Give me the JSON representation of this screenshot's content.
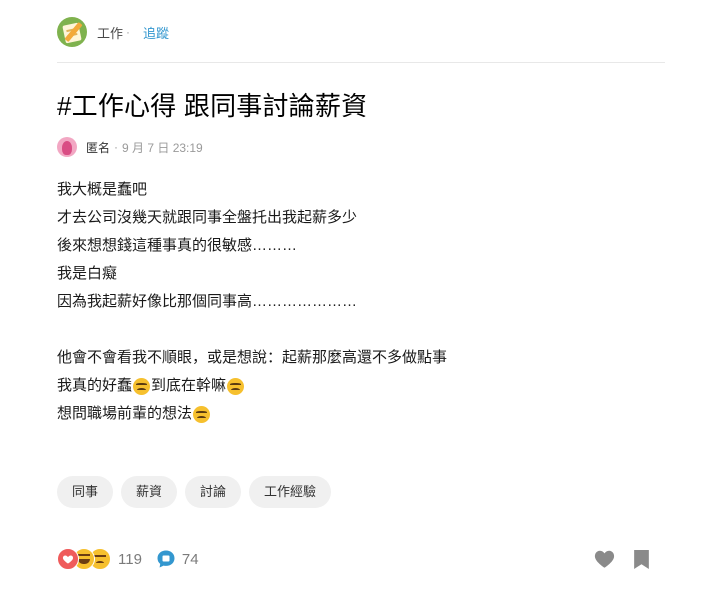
{
  "header": {
    "forum_name": "工作",
    "separator": "·",
    "follow_label": "追蹤"
  },
  "post": {
    "title": "#工作心得 跟同事討論薪資",
    "author": "匿名",
    "meta_separator": "·",
    "time": "9 月 7 日 23:19",
    "lines": [
      {
        "text": "我大概是蠢吧"
      },
      {
        "text": "才去公司沒幾天就跟同事全盤托出我起薪多少"
      },
      {
        "text": "後來想想錢這種事真的很敏感………"
      },
      {
        "text": "我是白癡"
      },
      {
        "text": "因為我起薪好像比那個同事高…………………"
      },
      {
        "text": ""
      },
      {
        "text": "他會不會看我不順眼，或是想說：起薪那麼高還不多做點事"
      },
      {
        "segments": [
          "我真的好蠢",
          "到底在幹嘛",
          ""
        ]
      },
      {
        "segments": [
          "想問職場前輩的想法",
          ""
        ]
      }
    ],
    "emoji_icon": "persevere-face-emoji"
  },
  "tags": [
    "同事",
    "薪資",
    "討論",
    "工作經驗"
  ],
  "footer": {
    "reactions": [
      "heart",
      "haha",
      "angry"
    ],
    "reaction_count": "119",
    "comment_count": "74"
  },
  "colors": {
    "accent_link": "#3397cf",
    "comment_icon": "#3397cf",
    "reaction_heart": "#ef5b5b",
    "emoji_yellow": "#f6c02e",
    "action_icon_gray": "#8a8a8a",
    "tag_background": "#f0f0f0"
  }
}
